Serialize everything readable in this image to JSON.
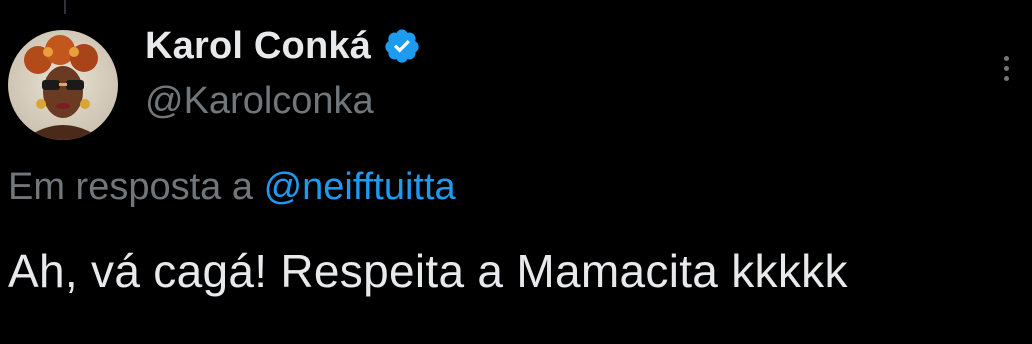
{
  "tweet": {
    "author": {
      "display_name": "Karol Conká",
      "handle": "@Karolconka",
      "verified_icon": "verified-badge-icon",
      "avatar": "avatar"
    },
    "reply_prefix": "Em resposta a",
    "reply_to": "@neifftuitta",
    "text": "Ah, vá cagá! Respeita a Mamacita kkkkk",
    "more_icon": "more-options-icon"
  },
  "colors": {
    "background": "#000000",
    "primary_text": "#e7e9ea",
    "secondary_text": "#71767b",
    "accent": "#1d9bf0"
  }
}
